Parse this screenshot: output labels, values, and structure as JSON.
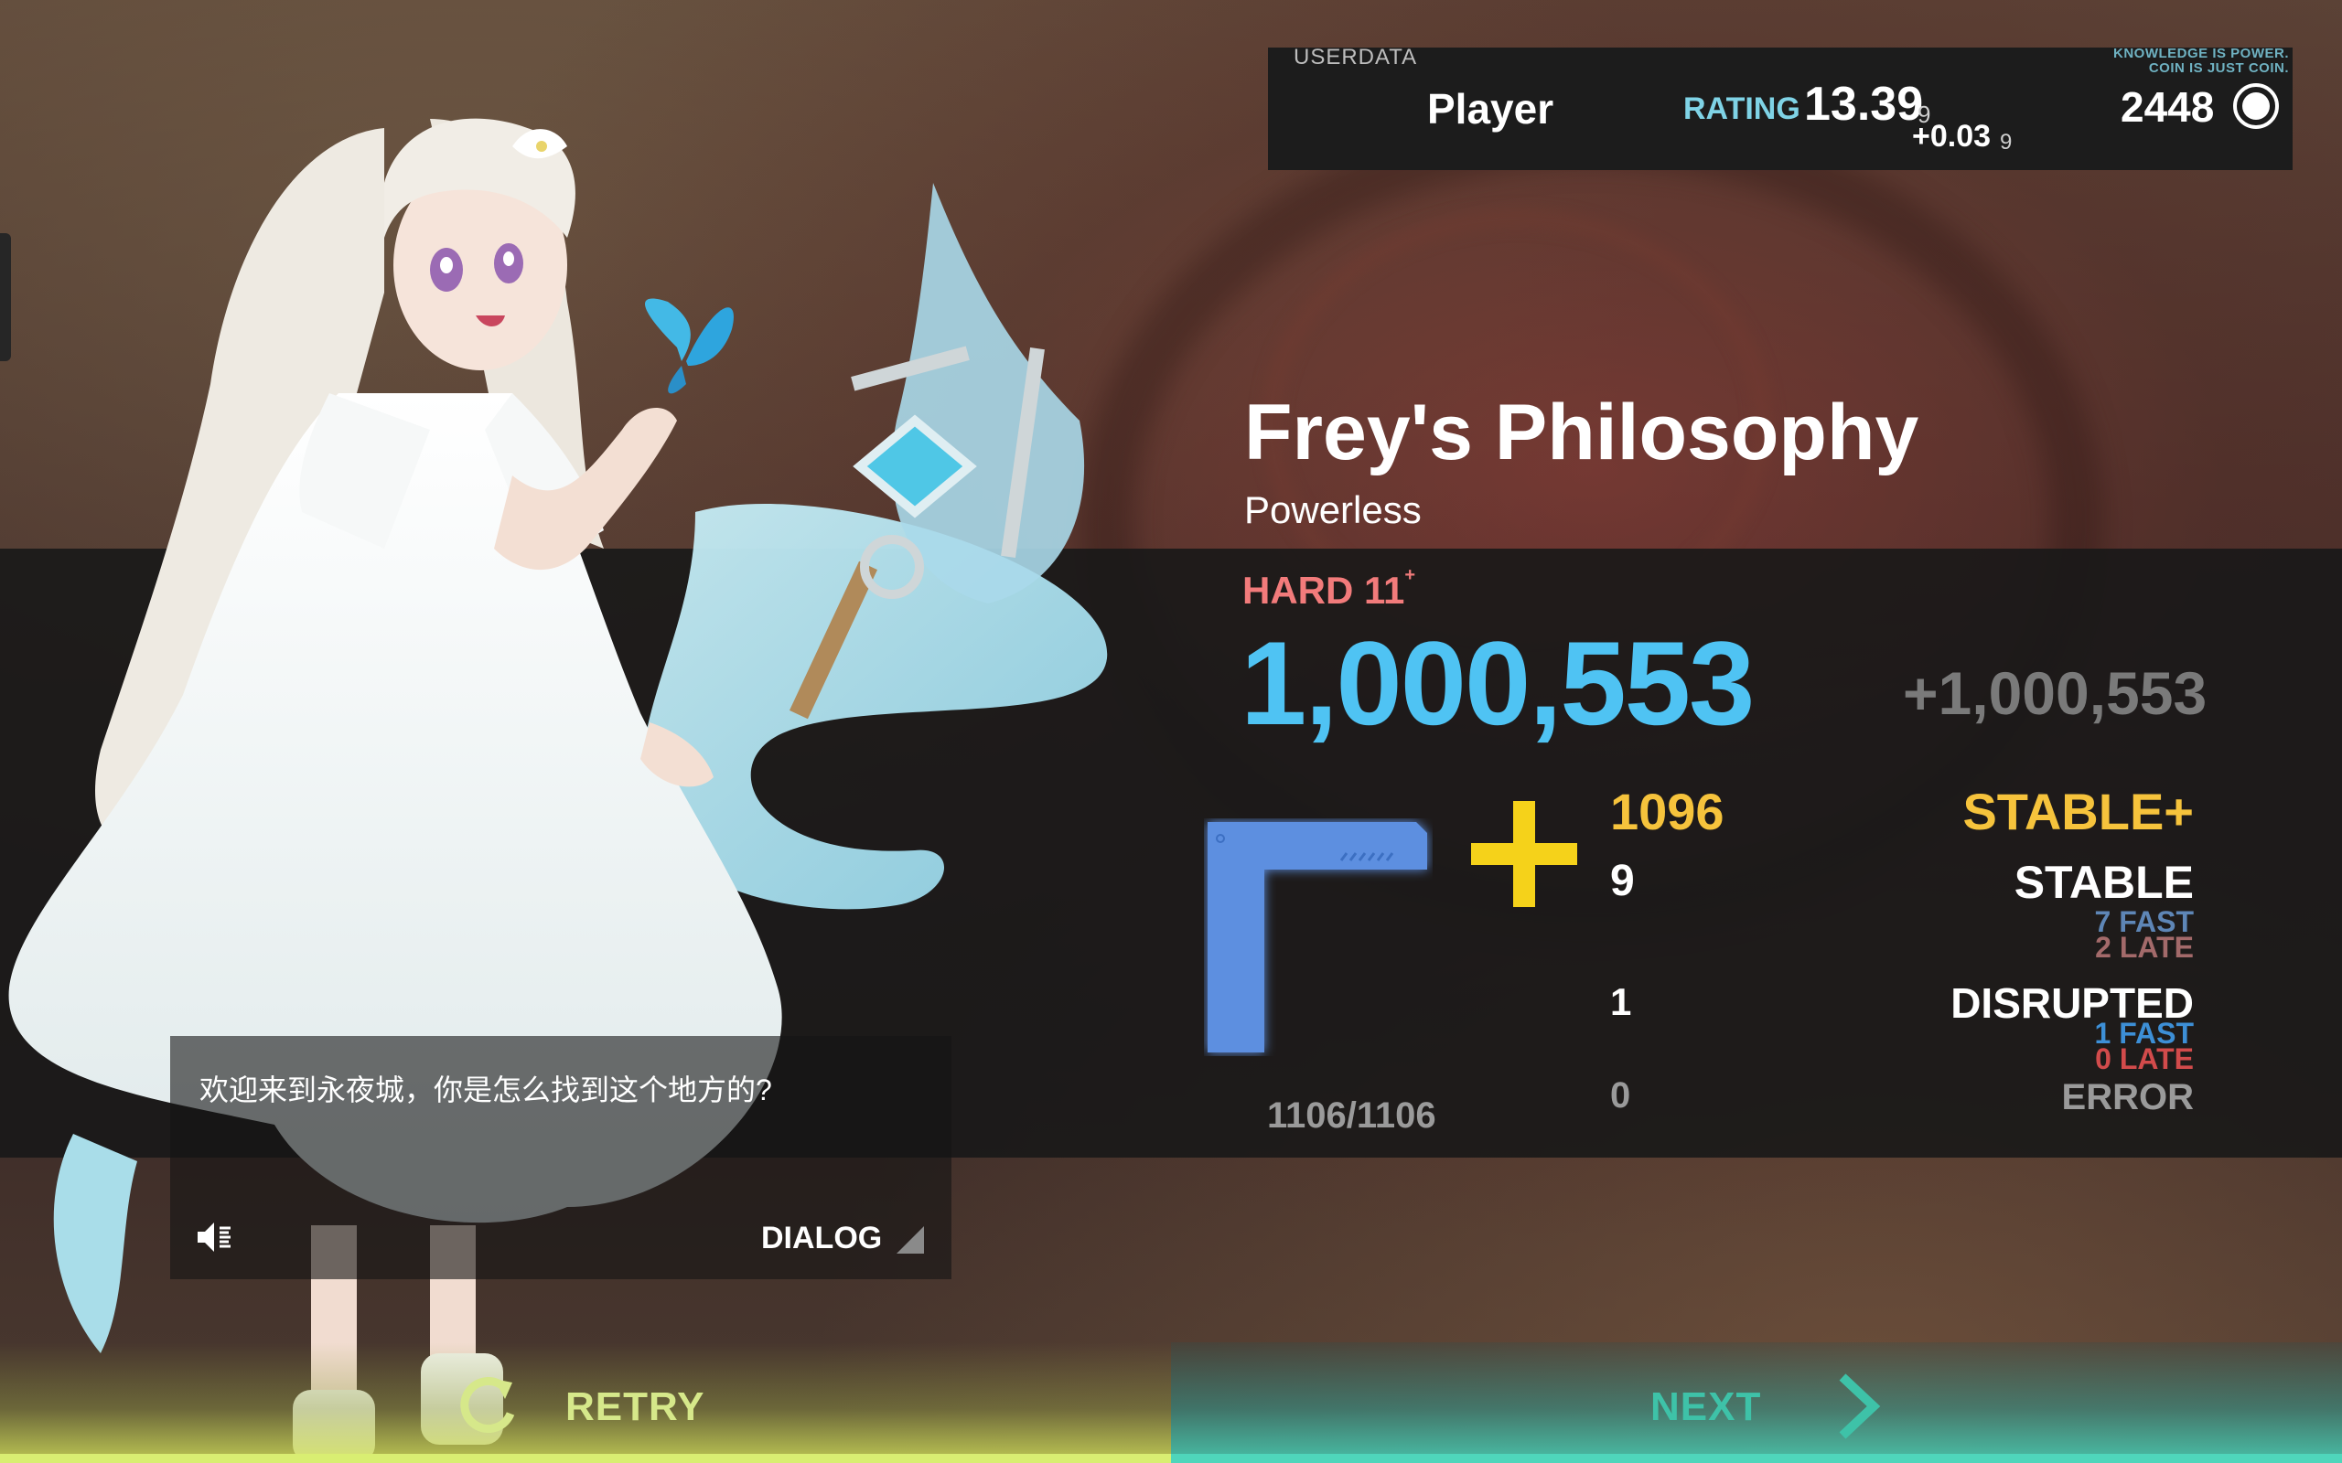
{
  "userdata": {
    "label": "USERDATA",
    "player_name": "Player",
    "rating_label": "RATING",
    "rating_value": "13.39",
    "rating_suffix": "9",
    "rating_delta": "+0.03",
    "rating_delta_suffix": "9",
    "motto_line1": "KNOWLEDGE IS POWER.",
    "motto_line2": "COIN IS JUST COIN.",
    "coins": "2448",
    "coin_icon": "coin-icon"
  },
  "song": {
    "title": "Frey's Philosophy",
    "artist": "Powerless",
    "difficulty": "HARD 11",
    "difficulty_plus": "+"
  },
  "result": {
    "score": "1,000,553",
    "score_delta": "+1,000,553",
    "grade_icon": "grade-icon",
    "plus_icon": "plus-icon",
    "notes_total": "1106/1106",
    "judgements": {
      "stable_plus": {
        "label": "STABLE+",
        "count": "1096"
      },
      "stable": {
        "label": "STABLE",
        "count": "9",
        "fast": "7 FAST",
        "late": "2 LATE"
      },
      "disrupted": {
        "label": "DISRUPTED",
        "count": "1",
        "fast": "1 FAST",
        "late": "0 LATE"
      },
      "error": {
        "label": "ERROR",
        "count": "0"
      }
    }
  },
  "dialog": {
    "text": "欢迎来到永夜城，你是怎么找到这个地方的?",
    "label": "DIALOG",
    "sound_icon": "speaker-muted-icon"
  },
  "buttons": {
    "retry": "RETRY",
    "next": "NEXT"
  },
  "colors": {
    "score_blue": "#4fc3f3",
    "stable_plus_gold": "#f6c33c",
    "difficulty_red": "#f27b7b",
    "retry_lime": "#d9ee72",
    "next_teal": "#4fd6bb"
  }
}
